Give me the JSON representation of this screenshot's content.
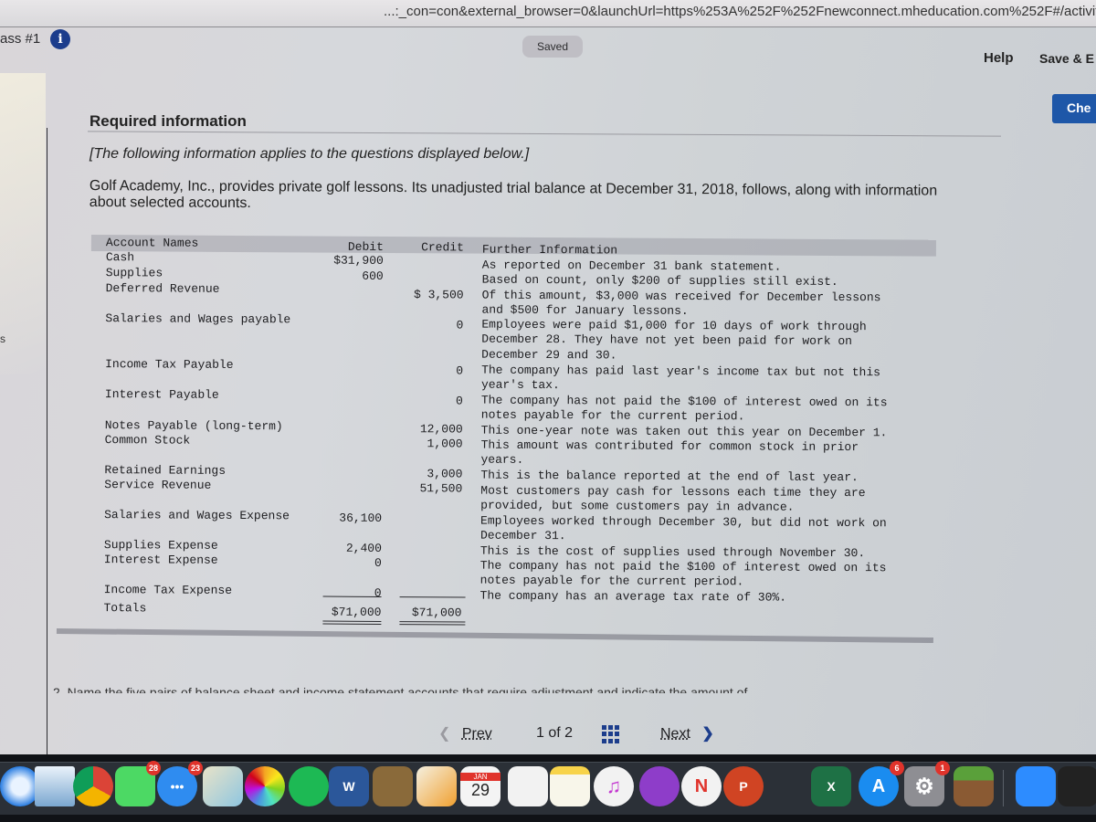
{
  "browser": {
    "url": "...:_con=con&external_browser=0&launchUrl=https%253A%252F%252Fnewconnect.mheducation.com%252F#/activity/questi"
  },
  "header": {
    "assignment_label": "ass #1",
    "info_icon": "i",
    "status_badge": "Saved",
    "help_label": "Help",
    "save_exit_label": "Save & E",
    "check_label": "Che"
  },
  "sidebar_fragment": "s",
  "question": {
    "title": "Required information",
    "note": "[The following information applies to the questions displayed below.]",
    "intro": "Golf Academy, Inc., provides private golf lessons. Its unadjusted trial balance at December 31, 2018, follows, along with information about selected accounts."
  },
  "trial_balance": {
    "headers": {
      "account": "Account Names",
      "debit": "Debit",
      "credit": "Credit",
      "info": "Further Information"
    },
    "rows": [
      {
        "account": "Cash",
        "debit": "$31,900",
        "credit": "",
        "info": [
          "As reported on December 31 bank statement."
        ]
      },
      {
        "account": "Supplies",
        "debit": "600",
        "credit": "",
        "info": [
          "Based on count, only $200 of supplies still exist."
        ]
      },
      {
        "account": "Deferred Revenue",
        "debit": "",
        "credit": "$ 3,500",
        "info": [
          "Of this amount, $3,000 was received for December lessons",
          "and $500 for January lessons."
        ]
      },
      {
        "account": "Salaries and Wages payable",
        "debit": "",
        "credit": "0",
        "info": [
          "Employees were paid $1,000 for 10 days of work through",
          "December 28. They have not yet been paid for work on",
          "December 29 and 30."
        ]
      },
      {
        "account": "Income Tax Payable",
        "debit": "",
        "credit": "0",
        "info": [
          "The company has paid last year's income tax but not this",
          "year's tax."
        ]
      },
      {
        "account": "Interest Payable",
        "debit": "",
        "credit": "0",
        "info": [
          "The company has not paid the $100 of interest owed on its",
          "notes payable for the current period."
        ]
      },
      {
        "account": "Notes Payable (long-term)",
        "debit": "",
        "credit": "12,000",
        "info": [
          "This one-year note was taken out this year on December 1."
        ]
      },
      {
        "account": "Common Stock",
        "debit": "",
        "credit": "1,000",
        "info": [
          "This amount was contributed for common stock in prior",
          "years."
        ]
      },
      {
        "account": "Retained Earnings",
        "debit": "",
        "credit": "3,000",
        "info": [
          "This is the balance reported at the end of last year."
        ]
      },
      {
        "account": "Service Revenue",
        "debit": "",
        "credit": "51,500",
        "info": [
          "Most customers pay cash for lessons each time they are",
          "provided, but some customers pay in advance."
        ]
      },
      {
        "account": "Salaries and Wages Expense",
        "debit": "36,100",
        "credit": "",
        "info": [
          "Employees worked through December 30, but did not work on",
          "December 31."
        ]
      },
      {
        "account": "Supplies Expense",
        "debit": "2,400",
        "credit": "",
        "info": [
          "This is the cost of supplies used through November 30."
        ]
      },
      {
        "account": "Interest Expense",
        "debit": "0",
        "credit": "",
        "info": [
          "The company has not paid the $100 of interest owed on its",
          "notes payable for the current period."
        ]
      },
      {
        "account": "Income Tax Expense",
        "debit": "0",
        "credit": "",
        "info": [
          "The company has an average tax rate of 30%."
        ]
      }
    ],
    "totals": {
      "label": "Totals",
      "debit": "$71,000",
      "credit": "$71,000"
    }
  },
  "next_question_preview": "2. Name the five pairs of balance sheet and income statement accounts that require adjustment and indicate the amount of",
  "pagination": {
    "prev_label": "Prev",
    "current": "1",
    "of_label": "of",
    "total": "2",
    "next_label": "Next"
  },
  "dock": {
    "apps": [
      {
        "name": "safari",
        "label": "",
        "badge": ""
      },
      {
        "name": "mail",
        "label": "",
        "badge": ""
      },
      {
        "name": "chrome",
        "label": "",
        "badge": ""
      },
      {
        "name": "facetime",
        "label": "",
        "badge": "28"
      },
      {
        "name": "messages",
        "label": "•••",
        "badge": "23"
      },
      {
        "name": "maps",
        "label": "",
        "badge": ""
      },
      {
        "name": "photos",
        "label": "",
        "badge": ""
      },
      {
        "name": "spotify",
        "label": "",
        "badge": ""
      },
      {
        "name": "word",
        "label": "W",
        "badge": ""
      },
      {
        "name": "notebook",
        "label": "",
        "badge": ""
      },
      {
        "name": "pages",
        "label": "",
        "badge": ""
      },
      {
        "name": "calendar",
        "label": "29",
        "month": "JAN",
        "badge": ""
      },
      {
        "name": "reminders",
        "label": "",
        "badge": ""
      },
      {
        "name": "notes",
        "label": "",
        "badge": ""
      },
      {
        "name": "itunes",
        "label": "♫",
        "badge": ""
      },
      {
        "name": "podcasts",
        "label": "",
        "badge": ""
      },
      {
        "name": "news",
        "label": "N",
        "badge": ""
      },
      {
        "name": "powerpoint",
        "label": "P",
        "badge": ""
      },
      {
        "name": "excel",
        "label": "X",
        "badge": ""
      },
      {
        "name": "app-store",
        "label": "A",
        "badge": "6"
      },
      {
        "name": "system-preferences",
        "label": "⚙",
        "badge": "1"
      },
      {
        "name": "minecraft",
        "label": "",
        "badge": ""
      },
      {
        "name": "zoom",
        "label": "",
        "badge": ""
      },
      {
        "name": "kindle",
        "label": "",
        "badge": ""
      }
    ]
  },
  "colors": {
    "accent_blue": "#1e57a8",
    "info_icon_blue": "#1c3d8c",
    "badge_red": "#e0332b",
    "dock_bg": "#2b3037"
  }
}
